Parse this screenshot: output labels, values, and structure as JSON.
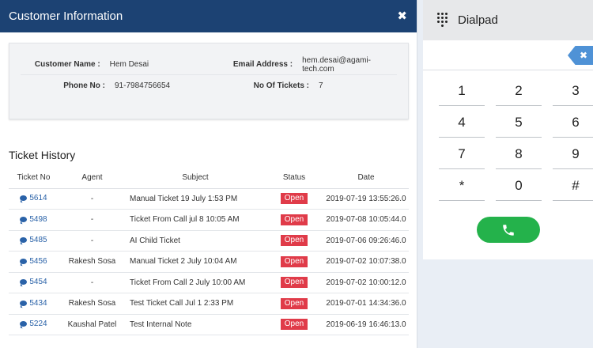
{
  "modal": {
    "title": "Customer Information",
    "close_label": "✖"
  },
  "customer": {
    "name_label": "Customer Name :",
    "name": "Hem Desai",
    "email_label": "Email Address :",
    "email": "hem.desai@agami-tech.com",
    "phone_label": "Phone No :",
    "phone": "91-7984756654",
    "tickets_label": "No Of Tickets :",
    "tickets": "7"
  },
  "history": {
    "title": "Ticket History",
    "columns": [
      "Ticket No",
      "Agent",
      "Subject",
      "Status",
      "Date"
    ],
    "rows": [
      {
        "no": "5614",
        "agent": "-",
        "subject": "Manual Ticket 19 July 1:53 PM",
        "status": "Open",
        "date": "2019-07-19 13:55:26.0"
      },
      {
        "no": "5498",
        "agent": "-",
        "subject": "Ticket From Call jul 8 10:05 AM",
        "status": "Open",
        "date": "2019-07-08 10:05:44.0"
      },
      {
        "no": "5485",
        "agent": "-",
        "subject": "AI Child Ticket",
        "status": "Open",
        "date": "2019-07-06 09:26:46.0"
      },
      {
        "no": "5456",
        "agent": "Rakesh Sosa",
        "subject": "Manual Ticket 2 July 10:04 AM",
        "status": "Open",
        "date": "2019-07-02 10:07:38.0"
      },
      {
        "no": "5454",
        "agent": "-",
        "subject": "Ticket From Call 2 July 10:00 AM",
        "status": "Open",
        "date": "2019-07-02 10:00:12.0"
      },
      {
        "no": "5434",
        "agent": "Rakesh Sosa",
        "subject": "Test Ticket Call Jul 1 2:33 PM",
        "status": "Open",
        "date": "2019-07-01 14:34:36.0"
      },
      {
        "no": "5224",
        "agent": "Kaushal Patel",
        "subject": "Test Internal Note",
        "status": "Open",
        "date": "2019-06-19 16:46:13.0"
      }
    ]
  },
  "dialpad": {
    "title": "Dialpad",
    "backspace_label": "✖",
    "keys": [
      "1",
      "2",
      "3",
      "4",
      "5",
      "6",
      "7",
      "8",
      "9",
      "*",
      "0",
      "#"
    ],
    "call_icon": "phone-icon"
  },
  "colors": {
    "header_bg": "#1c4273",
    "status_open": "#e03b49",
    "link": "#2a62a8",
    "call_button": "#24b24b",
    "backspace": "#4f92d6"
  }
}
